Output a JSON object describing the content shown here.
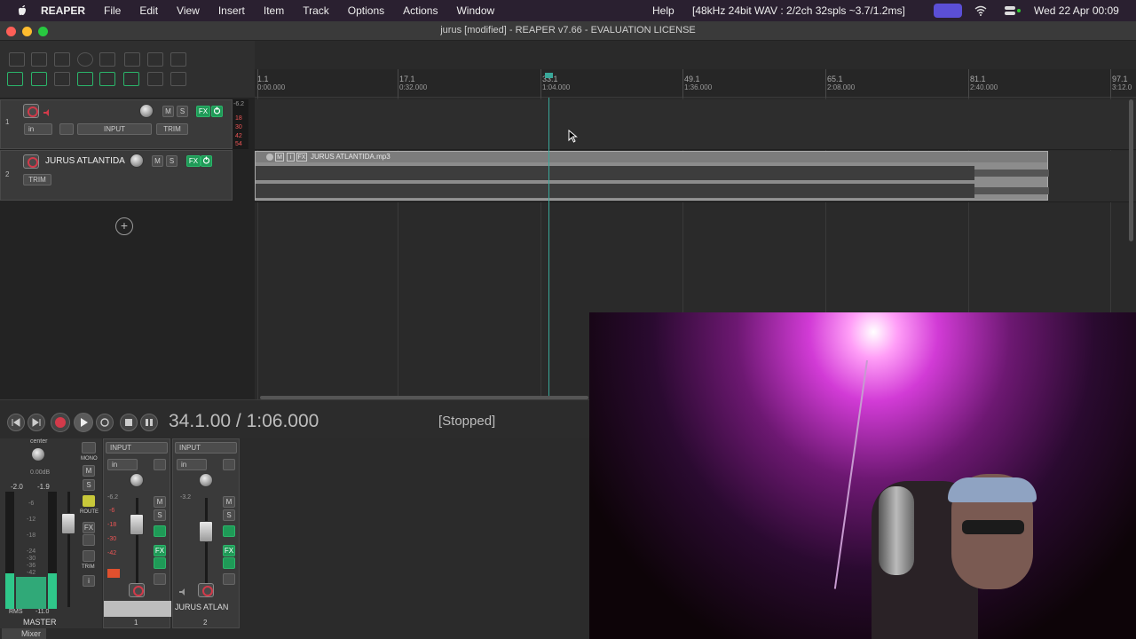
{
  "menubar": {
    "app_name": "REAPER",
    "items": [
      "File",
      "Edit",
      "View",
      "Insert",
      "Item",
      "Track",
      "Options",
      "Actions",
      "Window"
    ],
    "help": "Help",
    "audio_status": "[48kHz 24bit WAV : 2/2ch 32spls ~3.7/1.2ms]",
    "clock": "Wed 22 Apr  00:09"
  },
  "window": {
    "title": "jurus [modified] - REAPER v7.66 - EVALUATION LICENSE"
  },
  "tracks": [
    {
      "number": "1",
      "name": "",
      "input_label": "INPUT",
      "in_label": "in",
      "trim_label": "TRIM",
      "mute": "M",
      "solo": "S",
      "fx": "FX",
      "meter_values": [
        "-6.2",
        "18",
        "30",
        "42",
        "54"
      ]
    },
    {
      "number": "2",
      "name": "JURUS ATLANTIDA",
      "trim_label": "TRIM",
      "mute": "M",
      "solo": "S",
      "fx": "FX"
    }
  ],
  "add_track_symbol": "+",
  "ruler": {
    "marks": [
      {
        "bar": "1.1",
        "time": "0:00.000"
      },
      {
        "bar": "17.1",
        "time": "0:32.000"
      },
      {
        "bar": "33.1",
        "time": "1:04.000"
      },
      {
        "bar": "49.1",
        "time": "1:36.000"
      },
      {
        "bar": "65.1",
        "time": "2:08.000"
      },
      {
        "bar": "81.1",
        "time": "2:40.000"
      },
      {
        "bar": "97.1",
        "time": "3:12.0"
      }
    ]
  },
  "item": {
    "name": "JURUS ATLANTIDA.mp3",
    "badges": [
      "M",
      "i",
      "FX"
    ]
  },
  "transport": {
    "timecode": "34.1.00 / 1:06.000",
    "status": "[Stopped]"
  },
  "mixer": {
    "master": {
      "pan_label": "center",
      "db_label": "0.00dB",
      "peak_left": "-2.0",
      "peak_right": "-1.9",
      "mono": "MONO",
      "mute": "M",
      "solo": "S",
      "route": "ROUTE",
      "fx": "FX",
      "trim": "TRIM",
      "info": "i",
      "rms": "RMS",
      "rms_value": "-11.0",
      "name": "MASTER",
      "scale": [
        "-6",
        "-12",
        "-18",
        "-24",
        "-30",
        "-36",
        "-42"
      ]
    },
    "strips": [
      {
        "input_label": "INPUT",
        "in_label": "in",
        "meter_top": "-6.2",
        "scale": [
          "-6",
          "-18",
          "-30",
          "-42"
        ],
        "mute": "M",
        "solo": "S",
        "fx": "FX",
        "name": "",
        "number": "1"
      },
      {
        "input_label": "INPUT",
        "in_label": "in",
        "meter_top": "-3.2",
        "mute": "M",
        "solo": "S",
        "fx": "FX",
        "name": "JURUS ATLAN",
        "number": "2"
      }
    ],
    "tab_label": "Mixer"
  },
  "colors": {
    "accent_green": "#1f9a57",
    "record_red": "#d23a4a",
    "playhead": "#3aa89a"
  }
}
